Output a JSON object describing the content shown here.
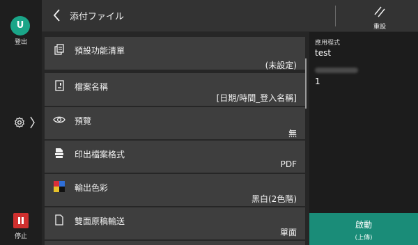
{
  "user": {
    "initial": "U",
    "logout_label": "登出"
  },
  "stop": {
    "label": "停止"
  },
  "header": {
    "title": "添付ファイル",
    "reset_label": "重設"
  },
  "items": [
    {
      "label": "預設功能清單",
      "value": "(未設定)",
      "icon": "preset-list-icon"
    },
    {
      "label": "檔案名稱",
      "value": "[日期/時間_登入名稱]",
      "icon": "file-name-icon"
    },
    {
      "label": "預覽",
      "value": "無",
      "icon": "eye-icon"
    },
    {
      "label": "印出檔案格式",
      "value": "PDF",
      "icon": "file-format-icon"
    },
    {
      "label": "輸出色彩",
      "value": "黑白(2色階)",
      "icon": "color-mode-icon"
    },
    {
      "label": "雙面原稿輸送",
      "value": "單面",
      "icon": "duplex-original-icon"
    }
  ],
  "side_panel": {
    "app_label": "應用程式",
    "app_name": "test",
    "count": "1"
  },
  "start": {
    "label": "啟動",
    "sub_label": "(上傳)"
  },
  "colors": {
    "accent": "#1a8c78",
    "avatar": "#1aa588",
    "stop": "#d0302f"
  }
}
